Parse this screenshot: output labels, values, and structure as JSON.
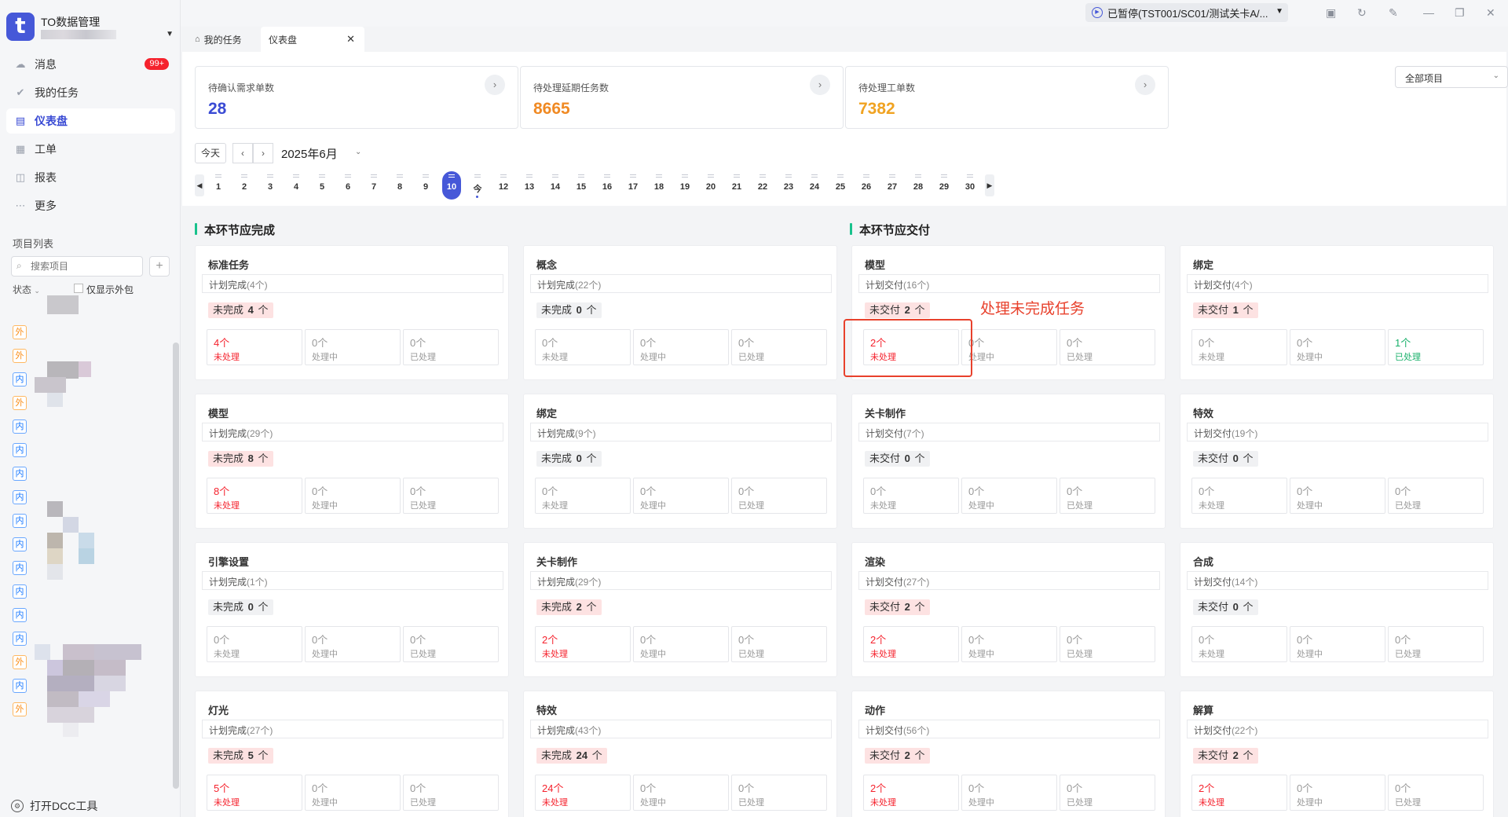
{
  "sidebar": {
    "app_title": "TO数据管理",
    "nav": [
      {
        "label": "消息",
        "icon": "message-icon",
        "badge": "99+"
      },
      {
        "label": "我的任务",
        "icon": "check-icon"
      },
      {
        "label": "仪表盘",
        "icon": "dashboard-icon",
        "active": true
      },
      {
        "label": "工单",
        "icon": "ticket-icon"
      },
      {
        "label": "报表",
        "icon": "report-icon"
      },
      {
        "label": "更多",
        "icon": "more-icon"
      }
    ],
    "project_list_title": "项目列表",
    "search_placeholder": "搜索项目",
    "status_label": "状态",
    "only_outsource_label": "仅显示外包",
    "tags": [
      "外",
      "外",
      "内",
      "外",
      "内",
      "内",
      "内",
      "内",
      "内",
      "内",
      "内",
      "内",
      "内",
      "内",
      "外",
      "内",
      "外"
    ],
    "footer_link": "打开DCC工具"
  },
  "window": {
    "status": "已暂停(TST001/SC01/测试关卡A/...",
    "tabs": [
      {
        "label": "我的任务",
        "icon": "home-icon"
      },
      {
        "label": "仪表盘",
        "active": true
      }
    ]
  },
  "kpis": [
    {
      "label": "待确认需求单数",
      "value": "28",
      "color": "#3a4bd4"
    },
    {
      "label": "待处理延期任务数",
      "value": "8665",
      "color": "#f08a24"
    },
    {
      "label": "待处理工单数",
      "value": "7382",
      "color": "#f0a322"
    }
  ],
  "project_select": "全部项目",
  "calendar": {
    "today_label": "今天",
    "month_label": "2025年6月",
    "days": [
      "1",
      "2",
      "3",
      "4",
      "5",
      "6",
      "7",
      "8",
      "9",
      "10",
      "今",
      "12",
      "13",
      "14",
      "15",
      "16",
      "17",
      "18",
      "19",
      "20",
      "21",
      "22",
      "23",
      "24",
      "25",
      "26",
      "27",
      "28",
      "29",
      "30"
    ],
    "selected_day": "10",
    "today_marker": "今"
  },
  "sections": {
    "complete_title": "本环节应完成",
    "deliver_title": "本环节应交付"
  },
  "labels": {
    "unprocessed": "未处理",
    "processing": "处理中",
    "processed": "已处理",
    "unit": "个"
  },
  "cards_complete": [
    {
      "name": "标准任务",
      "plan": "计划完成",
      "plan_count": "(4个)",
      "unf_label": "未完成",
      "unf": "4",
      "s": [
        "4个",
        "0个",
        "0个"
      ],
      "hot": [
        true,
        false,
        false
      ]
    },
    {
      "name": "概念",
      "plan": "计划完成",
      "plan_count": "(22个)",
      "unf_label": "未完成",
      "unf": "0",
      "s": [
        "0个",
        "0个",
        "0个"
      ],
      "hot": [
        false,
        false,
        false
      ]
    },
    {
      "name": "模型",
      "plan": "计划完成",
      "plan_count": "(29个)",
      "unf_label": "未完成",
      "unf": "8",
      "s": [
        "8个",
        "0个",
        "0个"
      ],
      "hot": [
        true,
        false,
        false
      ]
    },
    {
      "name": "绑定",
      "plan": "计划完成",
      "plan_count": "(9个)",
      "unf_label": "未完成",
      "unf": "0",
      "s": [
        "0个",
        "0个",
        "0个"
      ],
      "hot": [
        false,
        false,
        false
      ]
    },
    {
      "name": "引擎设置",
      "plan": "计划完成",
      "plan_count": "(1个)",
      "unf_label": "未完成",
      "unf": "0",
      "s": [
        "0个",
        "0个",
        "0个"
      ],
      "hot": [
        false,
        false,
        false
      ]
    },
    {
      "name": "关卡制作",
      "plan": "计划完成",
      "plan_count": "(29个)",
      "unf_label": "未完成",
      "unf": "2",
      "s": [
        "2个",
        "0个",
        "0个"
      ],
      "hot": [
        true,
        false,
        false
      ]
    },
    {
      "name": "灯光",
      "plan": "计划完成",
      "plan_count": "(27个)",
      "unf_label": "未完成",
      "unf": "5",
      "s": [
        "5个",
        "0个",
        "0个"
      ],
      "hot": [
        true,
        false,
        false
      ]
    },
    {
      "name": "特效",
      "plan": "计划完成",
      "plan_count": "(43个)",
      "unf_label": "未完成",
      "unf": "24",
      "s": [
        "24个",
        "0个",
        "0个"
      ],
      "hot": [
        true,
        false,
        false
      ]
    }
  ],
  "cards_deliver": [
    {
      "name": "模型",
      "plan": "计划交付",
      "plan_count": "(16个)",
      "unf_label": "未交付",
      "unf": "2",
      "s": [
        "2个",
        "0个",
        "0个"
      ],
      "hot": [
        true,
        false,
        false
      ]
    },
    {
      "name": "绑定",
      "plan": "计划交付",
      "plan_count": "(4个)",
      "unf_label": "未交付",
      "unf": "1",
      "s": [
        "0个",
        "0个",
        "1个"
      ],
      "hot": [
        false,
        false,
        true
      ]
    },
    {
      "name": "关卡制作",
      "plan": "计划交付",
      "plan_count": "(7个)",
      "unf_label": "未交付",
      "unf": "0",
      "s": [
        "0个",
        "0个",
        "0个"
      ],
      "hot": [
        false,
        false,
        false
      ]
    },
    {
      "name": "特效",
      "plan": "计划交付",
      "plan_count": "(19个)",
      "unf_label": "未交付",
      "unf": "0",
      "s": [
        "0个",
        "0个",
        "0个"
      ],
      "hot": [
        false,
        false,
        false
      ]
    },
    {
      "name": "渲染",
      "plan": "计划交付",
      "plan_count": "(27个)",
      "unf_label": "未交付",
      "unf": "2",
      "s": [
        "2个",
        "0个",
        "0个"
      ],
      "hot": [
        true,
        false,
        false
      ]
    },
    {
      "name": "合成",
      "plan": "计划交付",
      "plan_count": "(14个)",
      "unf_label": "未交付",
      "unf": "0",
      "s": [
        "0个",
        "0个",
        "0个"
      ],
      "hot": [
        false,
        false,
        false
      ]
    },
    {
      "name": "动作",
      "plan": "计划交付",
      "plan_count": "(56个)",
      "unf_label": "未交付",
      "unf": "2",
      "s": [
        "2个",
        "0个",
        "0个"
      ],
      "hot": [
        true,
        false,
        false
      ]
    },
    {
      "name": "解算",
      "plan": "计划交付",
      "plan_count": "(22个)",
      "unf_label": "未交付",
      "unf": "2",
      "s": [
        "2个",
        "0个",
        "0个"
      ],
      "hot": [
        true,
        false,
        false
      ]
    }
  ],
  "annotation": "处理未完成任务",
  "colors": {
    "accent": "#4658d8",
    "danger": "#f5222d",
    "success": "#18b06a",
    "section_bar": "#18c28c",
    "annotation": "#e8412c"
  }
}
